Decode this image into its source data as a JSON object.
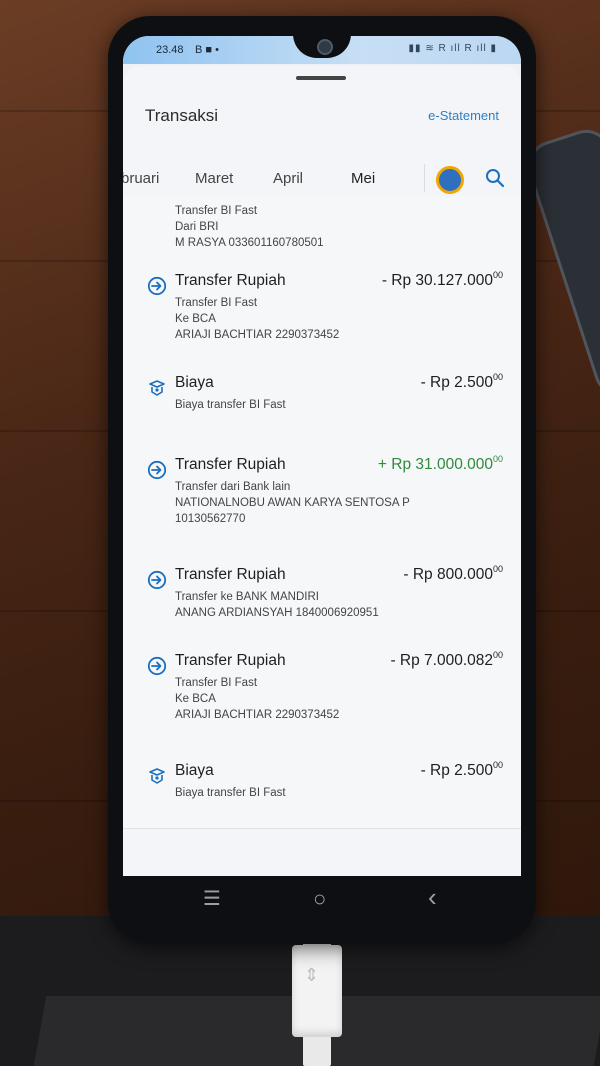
{
  "status_bar": {
    "time": "23.48",
    "icons": "B ■ •",
    "right_icons": "▮▮ ≋ R ıll R ıll ▮"
  },
  "header": {
    "title": "Transaksi",
    "estatement_label": "e-Statement"
  },
  "tabs": [
    {
      "label": "bruari"
    },
    {
      "label": "Maret"
    },
    {
      "label": "April"
    },
    {
      "label": "Mei",
      "active": true
    }
  ],
  "transactions": [
    {
      "title": "",
      "amount": "",
      "cents": "",
      "details": [
        "Transfer BI Fast",
        "Dari BRI",
        "M RASYA 033601160780501"
      ],
      "icon": "none"
    },
    {
      "title": "Transfer Rupiah",
      "amount": "- Rp 30.127.000",
      "cents": "00",
      "details": [
        "Transfer BI Fast",
        "Ke BCA",
        "ARIAJI BACHTIAR 2290373452"
      ],
      "icon": "transfer-icon"
    },
    {
      "title": "Biaya",
      "amount": "- Rp 2.500",
      "cents": "00",
      "details": [
        "Biaya transfer BI Fast"
      ],
      "icon": "fee-icon"
    },
    {
      "title": "Transfer Rupiah",
      "amount": "+ Rp 31.000.000",
      "cents": "00",
      "details": [
        "Transfer dari Bank lain",
        "NATIONALNOBU AWAN KARYA SENTOSA P",
        "10130562770"
      ],
      "icon": "transfer-icon",
      "positive": true
    },
    {
      "title": "Transfer Rupiah",
      "amount": "- Rp 800.000",
      "cents": "00",
      "details": [
        "Transfer ke BANK MANDIRI",
        "ANANG ARDIANSYAH 1840006920951"
      ],
      "icon": "transfer-icon"
    },
    {
      "title": "Transfer Rupiah",
      "amount": "- Rp 7.000.082",
      "cents": "00",
      "details": [
        "Transfer BI Fast",
        "Ke BCA",
        "ARIAJI BACHTIAR 2290373452"
      ],
      "icon": "transfer-icon"
    },
    {
      "title": "Biaya",
      "amount": "- Rp 2.500",
      "cents": "00",
      "details": [
        "Biaya transfer BI Fast"
      ],
      "icon": "fee-icon"
    }
  ],
  "nav": {
    "menu": "☰",
    "home": "○",
    "back": "‹"
  },
  "colors": {
    "accent": "#1a6fc0",
    "positive": "#2f8a3d",
    "link": "#2b7fc4"
  }
}
